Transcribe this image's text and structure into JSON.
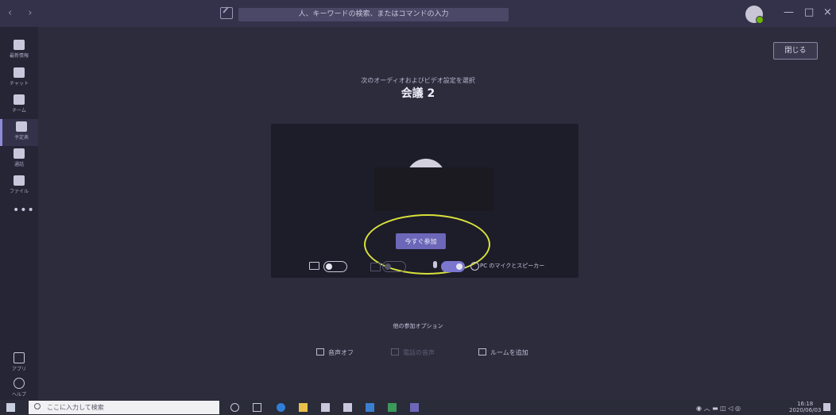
{
  "titlebar": {
    "nav_arrows": "‹ ›",
    "search_placeholder": "人、キーワードの検索、またはコマンドの入力",
    "window_controls": [
      "—",
      "□",
      "×"
    ]
  },
  "sidebar": {
    "items": [
      {
        "label": "最新情報",
        "icon": "bell-icon"
      },
      {
        "label": "チャット",
        "icon": "chat-icon"
      },
      {
        "label": "チーム",
        "icon": "teams-icon"
      },
      {
        "label": "予定表",
        "icon": "calendar-icon"
      },
      {
        "label": "通話",
        "icon": "phone-icon"
      },
      {
        "label": "ファイル",
        "icon": "file-icon"
      }
    ],
    "more": "•••",
    "bottom": [
      {
        "label": "アプリ",
        "icon": "apps-icon"
      },
      {
        "label": "ヘルプ",
        "icon": "help-icon"
      }
    ]
  },
  "main": {
    "close_label": "閉じる",
    "subtitle": "次のオーディオおよびビデオ設定を選択",
    "title": "会議 2",
    "join_label": "今すぐ参加",
    "audio_device": "PC のマイクとスピーカー",
    "other_options_title": "他の参加オプション",
    "options": [
      {
        "label": "音声オフ",
        "icon": "speaker-off-icon",
        "enabled": true
      },
      {
        "label": "電話の音声",
        "icon": "phone-audio-icon",
        "enabled": false
      },
      {
        "label": "ルームを追加",
        "icon": "cast-icon",
        "enabled": true
      }
    ],
    "toggles": {
      "camera": "off",
      "blur": "off",
      "microphone": "on"
    }
  },
  "taskbar": {
    "search_placeholder": "ここに入力して検索",
    "clock_time": "16:18",
    "clock_date": "2020/06/03"
  },
  "colors": {
    "accent": "#6c67b8",
    "annotation_circle": "#d8e23a",
    "background": "#2d2c3d"
  }
}
